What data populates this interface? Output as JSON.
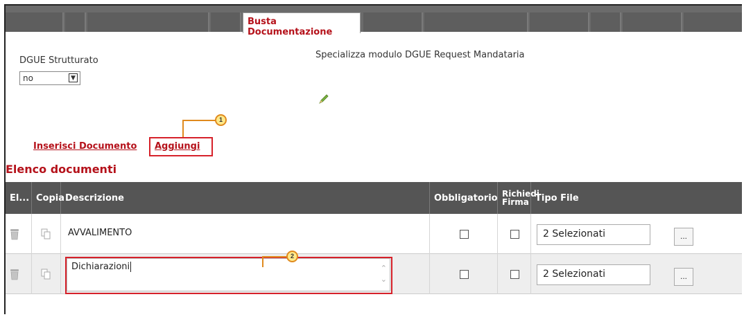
{
  "tabs": {
    "active_label": "Busta Documentazione"
  },
  "form": {
    "dgue_label": "DGUE Strutturato",
    "dgue_value": "no",
    "specializza_label": "Specializza modulo DGUE Request Mandataria"
  },
  "actions": {
    "inserisci_label": "Inserisci Documento",
    "aggiungi_label": "Aggiungi"
  },
  "callouts": [
    "1",
    "2"
  ],
  "section_title": "Elenco documenti",
  "table": {
    "columns": {
      "el": "El...",
      "copia": "Copia",
      "descrizione": "Descrizione",
      "obbligatorio": "Obbligatorio",
      "richiedi_firma_1": "Richiedi",
      "richiedi_firma_2": "Firma",
      "tipo_file": "Tipo File"
    },
    "rows": [
      {
        "descrizione": "AVVALIMENTO",
        "tipo_file": "2 Selezionati",
        "more": "..."
      },
      {
        "descrizione": "Dichiarazioni",
        "tipo_file": "2 Selezionati",
        "more": "..."
      }
    ]
  },
  "colors": {
    "accent": "#b5121b",
    "header_bg": "#555555",
    "callout": "#e08a1e",
    "highlight": "#d6212a"
  }
}
